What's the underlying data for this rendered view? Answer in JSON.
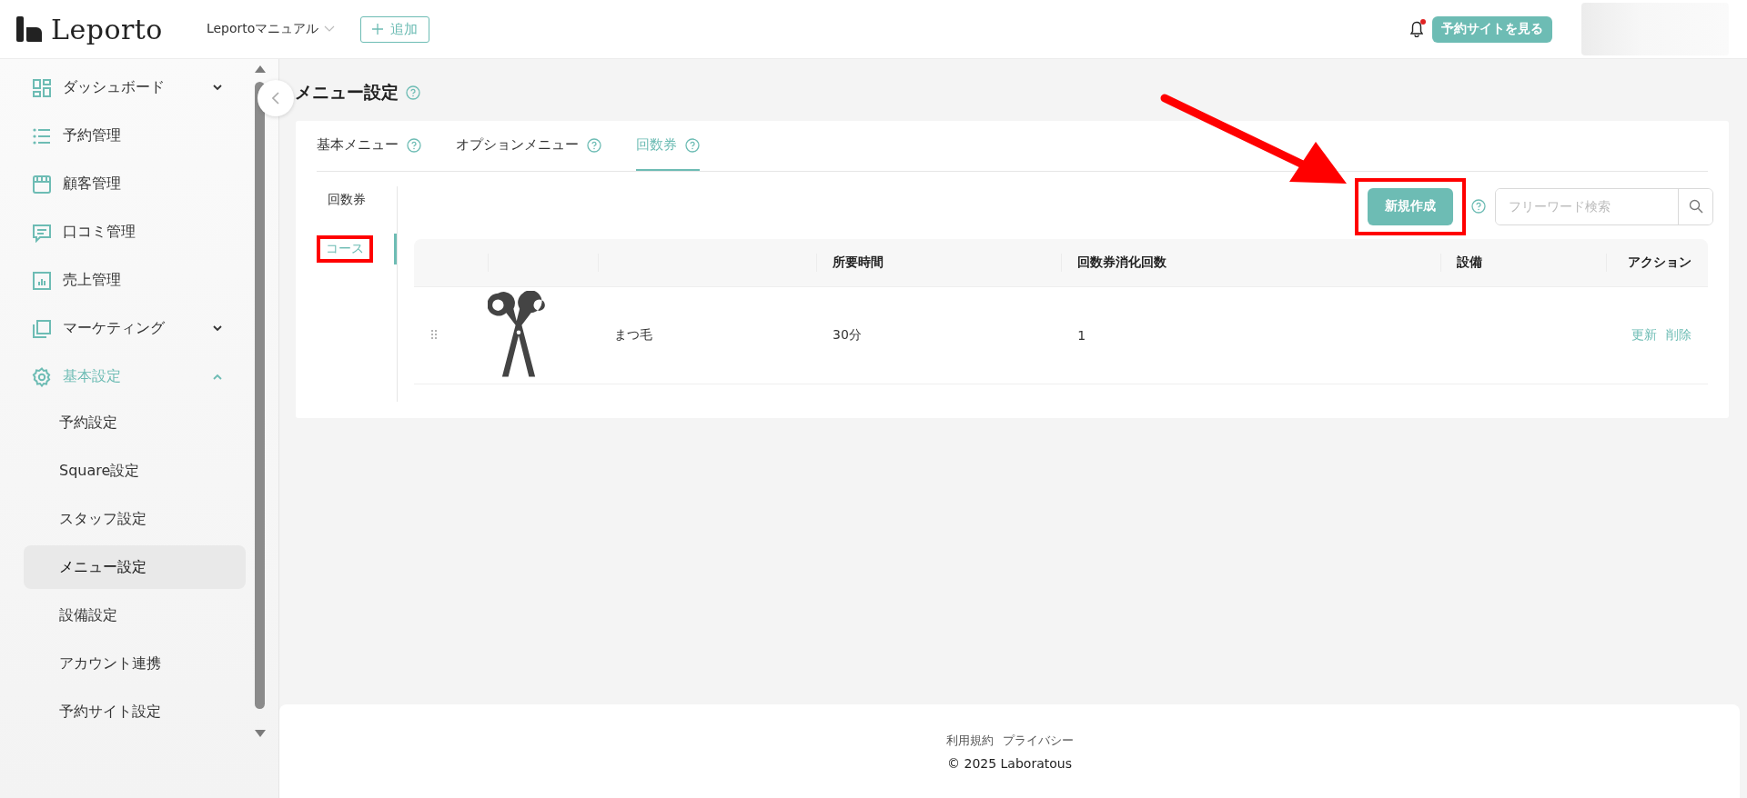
{
  "header": {
    "logo": "Leporto",
    "store_selector": "Leportoマニュアル",
    "add_button": "追加",
    "notifications": {
      "unread": true
    },
    "view_site_button": "予約サイトを見る"
  },
  "sidebar": {
    "items": [
      {
        "label": "ダッシュボード",
        "kind": "group",
        "expanded": false,
        "active": false
      },
      {
        "label": "予約管理",
        "kind": "link",
        "active": false
      },
      {
        "label": "顧客管理",
        "kind": "link",
        "active": false
      },
      {
        "label": "口コミ管理",
        "kind": "link",
        "active": false
      },
      {
        "label": "売上管理",
        "kind": "link",
        "active": false
      },
      {
        "label": "マーケティング",
        "kind": "group",
        "expanded": false,
        "active": false
      },
      {
        "label": "基本設定",
        "kind": "group",
        "expanded": true,
        "active": true,
        "children": [
          {
            "label": "予約設定",
            "selected": false
          },
          {
            "label": "Square設定",
            "selected": false
          },
          {
            "label": "スタッフ設定",
            "selected": false
          },
          {
            "label": "メニュー設定",
            "selected": true
          },
          {
            "label": "設備設定",
            "selected": false
          },
          {
            "label": "アカウント連携",
            "selected": false
          },
          {
            "label": "予約サイト設定",
            "selected": false
          }
        ]
      }
    ]
  },
  "page": {
    "title": "メニュー設定",
    "tabs": [
      {
        "label": "基本メニュー",
        "selected": false
      },
      {
        "label": "オプションメニュー",
        "selected": false
      },
      {
        "label": "回数券",
        "selected": true
      }
    ],
    "sub_nav": [
      {
        "label": "回数券",
        "selected": false,
        "highlighted": false
      },
      {
        "label": "コース",
        "selected": true,
        "highlighted": true
      }
    ],
    "new_button": {
      "label": "新規作成",
      "highlighted": true
    },
    "search": {
      "placeholder": "フリーワード検索"
    },
    "table": {
      "columns": [
        "所要時間",
        "回数券消化回数",
        "設備",
        "アクション"
      ],
      "rows": [
        {
          "name": "まつ毛",
          "duration": "30分",
          "uses": "1",
          "actions": [
            "更新",
            "削除"
          ]
        }
      ]
    }
  },
  "footer": {
    "links": [
      "利用規約",
      "プライバシー"
    ],
    "copyright": "© 2025 Laboratous"
  }
}
